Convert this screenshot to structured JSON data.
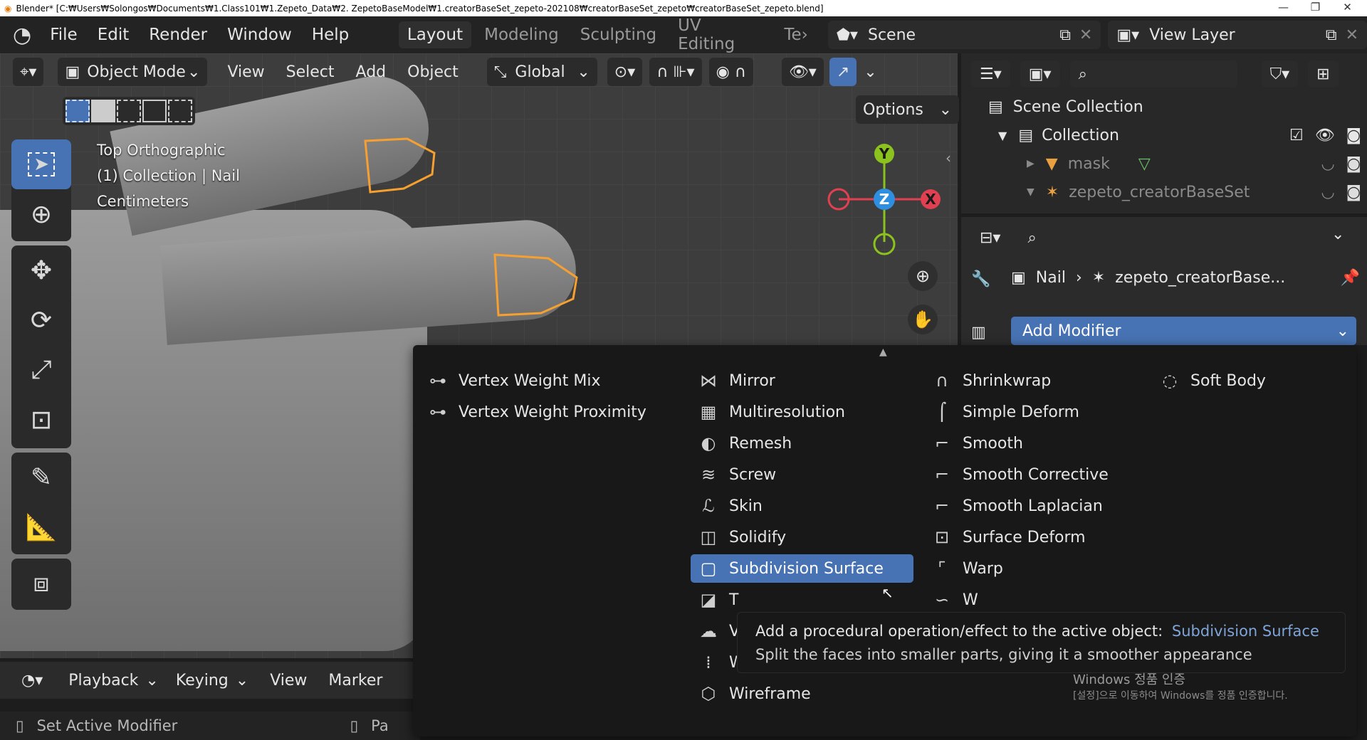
{
  "window": {
    "title": "Blender* [C:₩Users₩Solongos₩Documents₩1.Class101₩1.Zepeto_Data₩2. ZepetoBaseModel₩1.creatorBaseSet_zepeto-202108₩creatorBaseSet_zepeto₩creatorBaseSet_zepeto.blend]",
    "controls": [
      "—",
      "❐",
      "✕"
    ]
  },
  "menubar": {
    "items": [
      "File",
      "Edit",
      "Render",
      "Window",
      "Help"
    ],
    "workspaces": [
      "Layout",
      "Modeling",
      "Sculpting",
      "UV Editing",
      "Te›"
    ],
    "scene": "Scene",
    "view_layer": "View Layer"
  },
  "viewport_header": {
    "mode": "Object Mode",
    "menus": [
      "View",
      "Select",
      "Add",
      "Object"
    ],
    "orientation": "Global",
    "options": "Options"
  },
  "viewport_overlay": {
    "view_name": "Top Orthographic",
    "object_info": "(1) Collection | Nail",
    "units": "Centimeters"
  },
  "gizmo": {
    "y": "Y",
    "z": "Z",
    "x": "X"
  },
  "outliner": {
    "scene_collection": "Scene Collection",
    "collection": "Collection",
    "items": [
      "mask",
      "zepeto_creatorBaseSet"
    ]
  },
  "properties": {
    "object": "Nail",
    "modifier_target": "zepeto_creatorBase...",
    "add_modifier": "Add Modifier"
  },
  "modifier_menu": {
    "col1": [
      "Vertex Weight Mix",
      "Vertex Weight Proximity"
    ],
    "col2": [
      "Mirror",
      "Multiresolution",
      "Remesh",
      "Screw",
      "Skin",
      "Solidify",
      "Subdivision Surface",
      "T",
      "V",
      "Weld",
      "Wireframe"
    ],
    "col3": [
      "Shrinkwrap",
      "Simple Deform",
      "Smooth",
      "Smooth Corrective",
      "Smooth Laplacian",
      "Surface Deform",
      "Warp",
      "W"
    ],
    "col4": [
      "Soft Body"
    ],
    "highlighted": "Subdivision Surface"
  },
  "tooltip": {
    "line1_prefix": "Add a procedural operation/effect to the active object:",
    "line1_highlight": "Subdivision Surface",
    "line2": "Split the faces into smaller parts, giving it a smoother appearance"
  },
  "watermark": {
    "line1": "Windows 정품 인증",
    "line2": "[설정]으로 이동하여 Windows를 정품 인증합니다."
  },
  "timeline": {
    "menus": [
      "Playback",
      "Keying",
      "View",
      "Marker"
    ]
  },
  "statusbar": {
    "left": "Set Active Modifier",
    "right": "Pa"
  },
  "colors": {
    "accent": "#4772b3",
    "selection_outline": "#f5a030",
    "axis_x": "#e04050",
    "axis_y": "#8cc21e",
    "axis_z": "#2e8fe0"
  }
}
